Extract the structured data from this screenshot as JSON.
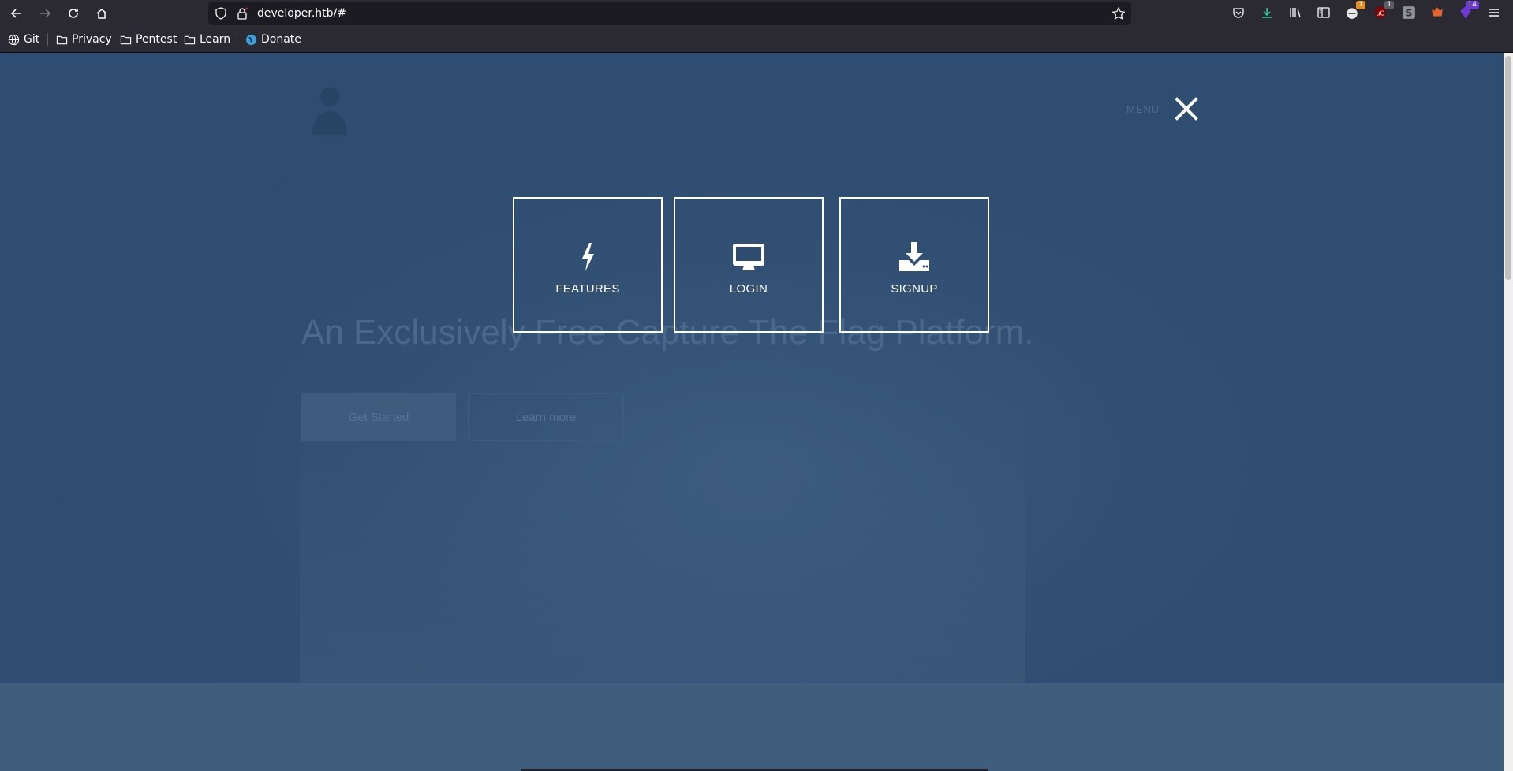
{
  "browser": {
    "url": "developer.htb/#",
    "bookmarks": [
      "Git",
      "Privacy",
      "Pentest",
      "Learn",
      "Donate"
    ],
    "badges": {
      "extension1": "1",
      "extension2": "1",
      "extension3": "14"
    }
  },
  "page": {
    "menu_label": "MENU",
    "hero_heading": "An Exclusively Free Capture The Flag Platform.",
    "hero_primary_button": "Get Started",
    "hero_secondary_button": "Learn more",
    "overlay_tiles": [
      {
        "label": "FEATURES",
        "icon": "bolt-icon"
      },
      {
        "label": "LOGIN",
        "icon": "monitor-icon"
      },
      {
        "label": "SIGNUP",
        "icon": "download-icon"
      }
    ]
  },
  "colors": {
    "overlay": "#2e4d70",
    "tile_border": "#ffffff",
    "browser_chrome": "#2b2a33"
  }
}
